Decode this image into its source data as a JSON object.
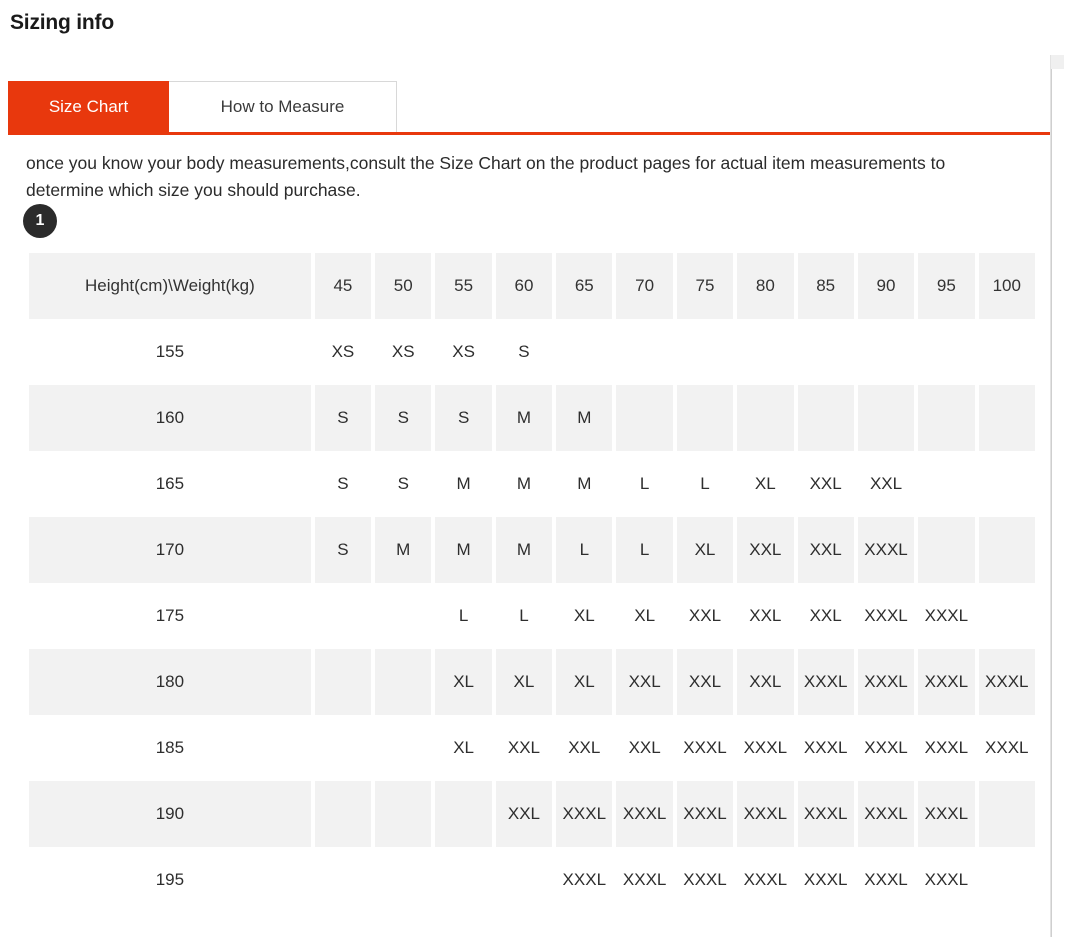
{
  "page_title": "Sizing info",
  "tabs": [
    {
      "label": "Size Chart",
      "active": true
    },
    {
      "label": "How to Measure",
      "active": false
    }
  ],
  "description": "once you know your body measurements,consult the Size Chart on the product pages for actual item measurements to determine which size you should purchase.",
  "step_badge": "1",
  "colors": {
    "accent": "#e8380d",
    "row_shade": "#f2f2f2",
    "text": "#2e2e2e",
    "badge_bg": "#2b2b2b"
  },
  "chart_data": {
    "type": "table",
    "title": "Size Chart",
    "corner_label": "Height(cm)\\Weight(kg)",
    "xlabel": "Weight(kg)",
    "ylabel": "Height(cm)",
    "categories": [
      "45",
      "50",
      "55",
      "60",
      "65",
      "70",
      "75",
      "80",
      "85",
      "90",
      "95",
      "100"
    ],
    "row_labels": [
      "155",
      "160",
      "165",
      "170",
      "175",
      "180",
      "185",
      "190",
      "195"
    ],
    "rows": [
      {
        "height": "155",
        "sizes": [
          "XS",
          "XS",
          "XS",
          "S",
          "",
          "",
          "",
          "",
          "",
          "",
          "",
          ""
        ]
      },
      {
        "height": "160",
        "sizes": [
          "S",
          "S",
          "S",
          "M",
          "M",
          "",
          "",
          "",
          "",
          "",
          "",
          ""
        ]
      },
      {
        "height": "165",
        "sizes": [
          "S",
          "S",
          "M",
          "M",
          "M",
          "L",
          "L",
          "XL",
          "XXL",
          "XXL",
          "",
          ""
        ]
      },
      {
        "height": "170",
        "sizes": [
          "S",
          "M",
          "M",
          "M",
          "L",
          "L",
          "XL",
          "XXL",
          "XXL",
          "XXXL",
          "",
          ""
        ]
      },
      {
        "height": "175",
        "sizes": [
          "",
          "",
          "L",
          "L",
          "XL",
          "XL",
          "XXL",
          "XXL",
          "XXL",
          "XXXL",
          "XXXL",
          ""
        ]
      },
      {
        "height": "180",
        "sizes": [
          "",
          "",
          "XL",
          "XL",
          "XL",
          "XXL",
          "XXL",
          "XXL",
          "XXXL",
          "XXXL",
          "XXXL",
          "XXXL"
        ]
      },
      {
        "height": "185",
        "sizes": [
          "",
          "",
          "XL",
          "XXL",
          "XXL",
          "XXL",
          "XXXL",
          "XXXL",
          "XXXL",
          "XXXL",
          "XXXL",
          "XXXL"
        ]
      },
      {
        "height": "190",
        "sizes": [
          "",
          "",
          "",
          "XXL",
          "XXXL",
          "XXXL",
          "XXXL",
          "XXXL",
          "XXXL",
          "XXXL",
          "XXXL",
          ""
        ]
      },
      {
        "height": "195",
        "sizes": [
          "",
          "",
          "",
          "",
          "XXXL",
          "XXXL",
          "XXXL",
          "XXXL",
          "XXXL",
          "XXXL",
          "XXXL",
          ""
        ]
      }
    ]
  }
}
